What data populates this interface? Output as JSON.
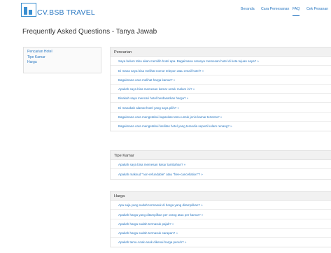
{
  "header": {
    "logo_text": "CV.BSB TRAVEL",
    "nav": [
      "Beranda",
      "Cara Pemesanan",
      "FAQ",
      "Cek Pesanan"
    ]
  },
  "page_title": "Frequently Asked Questions - Tanya Jawab",
  "sidebar": {
    "items": [
      "Pencarian Hotel",
      "Tipe Kamar",
      "Harga"
    ]
  },
  "sections": [
    {
      "title": "Pencarian",
      "items": [
        "Saya belum tahu akan memilih hotel apa. Bagaimana caranya memesan hotel di kota tujuan saya? »",
        "Di mana saya bisa melihat nomor telepon atau email hotel? »",
        "Bagaimana cara melihat harga kamar? »",
        "Apakah saya bisa memesan kamar untuk malam ini? »",
        "Bisakah saya mencari hotel berdasarkan harga? »",
        "Di manakah alamat hotel yang saya pilih? »",
        "Bagaimana cara mengetahui kapasitas tamu untuk jenis kamar tertentu? »",
        "Bagaimana cara mengetahui fasilitas hotel yang tersedia seperti kolam renang? »"
      ]
    },
    {
      "title": "Tipe Kamar",
      "items": [
        "Apakah saya bisa memesan kasur tambahan? »",
        "Apakah maksud \"non-refundable\" atau \"free-cancellation\"? »"
      ]
    },
    {
      "title": "Harga",
      "items": [
        "Apa saja yang sudah termasuk di harga yang ditampilkan? »",
        "Apakah harga yang ditampilkan per orang atau per kamar? »",
        "Apakah harga sudah termasuk pajak? »",
        "Apakah harga sudah termasuk sarapan? »",
        "Apakah tamu Anak-anak dikenai harga penuh? »"
      ]
    }
  ]
}
